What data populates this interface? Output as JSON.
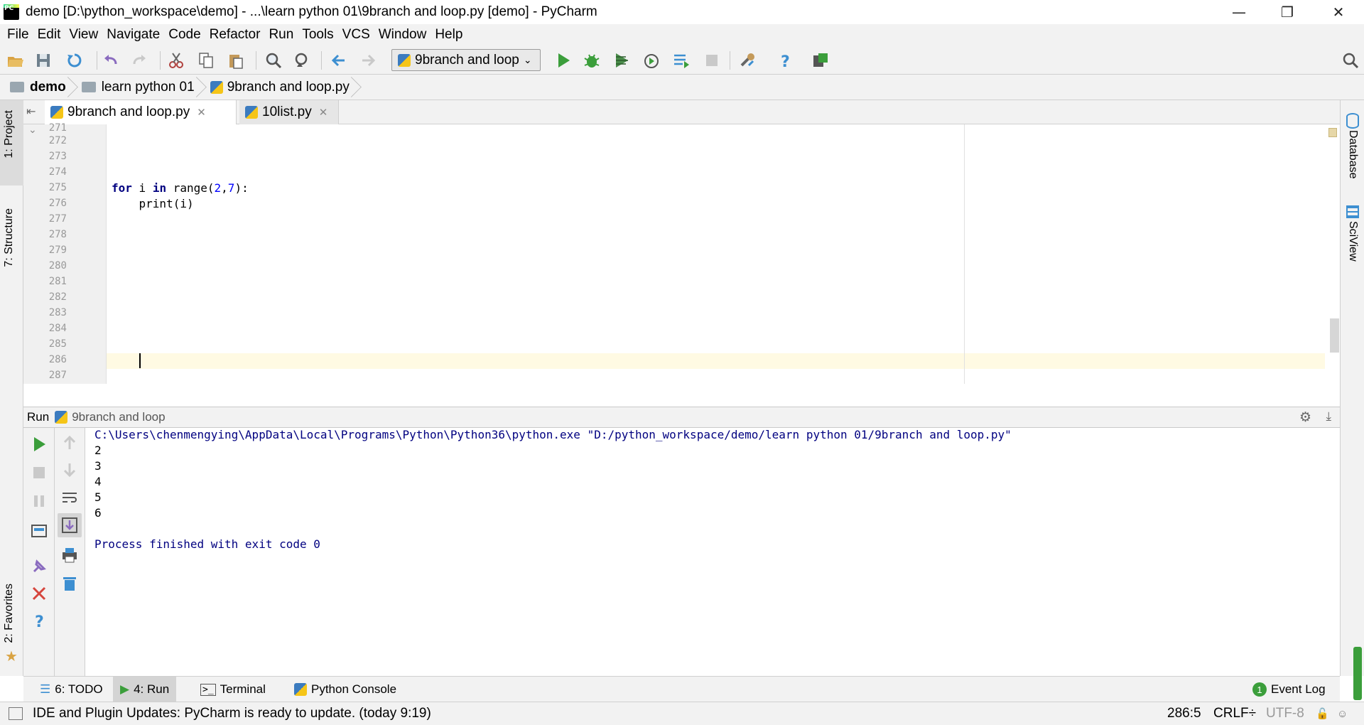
{
  "window": {
    "title": "demo [D:\\python_workspace\\demo] - ...\\learn python 01\\9branch and loop.py [demo] - PyCharm"
  },
  "menu": [
    "File",
    "Edit",
    "View",
    "Navigate",
    "Code",
    "Refactor",
    "Run",
    "Tools",
    "VCS",
    "Window",
    "Help"
  ],
  "toolbar": {
    "run_config": "9branch and loop"
  },
  "breadcrumb": [
    "demo",
    "learn python 01",
    "9branch and loop.py"
  ],
  "left_stripe": {
    "project": "1: Project",
    "structure": "7: Structure",
    "favorites": "2: Favorites"
  },
  "right_stripe": {
    "database": "Database",
    "sciview": "SciView"
  },
  "editor_tabs": [
    "9branch and loop.py",
    "10list.py"
  ],
  "editor": {
    "line_numbers": [
      "271",
      "272",
      "273",
      "274",
      "275",
      "276",
      "277",
      "278",
      "279",
      "280",
      "281",
      "282",
      "283",
      "284",
      "285",
      "286",
      "287"
    ],
    "code_line_275": {
      "for": "for",
      "i": " i ",
      "in": "in",
      "rest_a": " range(",
      "n1": "2",
      "comma": ",",
      "n2": "7",
      "rest_b": "):"
    },
    "code_line_276": "    print(i)"
  },
  "run_panel": {
    "label": "Run",
    "config": "9branch and loop",
    "command": "C:\\Users\\chenmengying\\AppData\\Local\\Programs\\Python\\Python36\\python.exe \"D:/python_workspace/demo/learn python 01/9branch and loop.py\"",
    "output": [
      "2",
      "3",
      "4",
      "5",
      "6"
    ],
    "exit_message": "Process finished with exit code 0"
  },
  "bottom_tabs": {
    "todo": "6: TODO",
    "run": "4: Run",
    "terminal": "Terminal",
    "python_console": "Python Console",
    "event_log": "Event Log",
    "event_count": "1"
  },
  "status": {
    "message": "IDE and Plugin Updates: PyCharm is ready to update. (today 9:19)",
    "position": "286:5",
    "line_sep": "CRLF÷",
    "encoding": "UTF-8"
  },
  "colors": {
    "run_green": "#3b9e3b",
    "keyword": "#000080",
    "number": "#0000ff",
    "caret_line": "#fffae3"
  }
}
